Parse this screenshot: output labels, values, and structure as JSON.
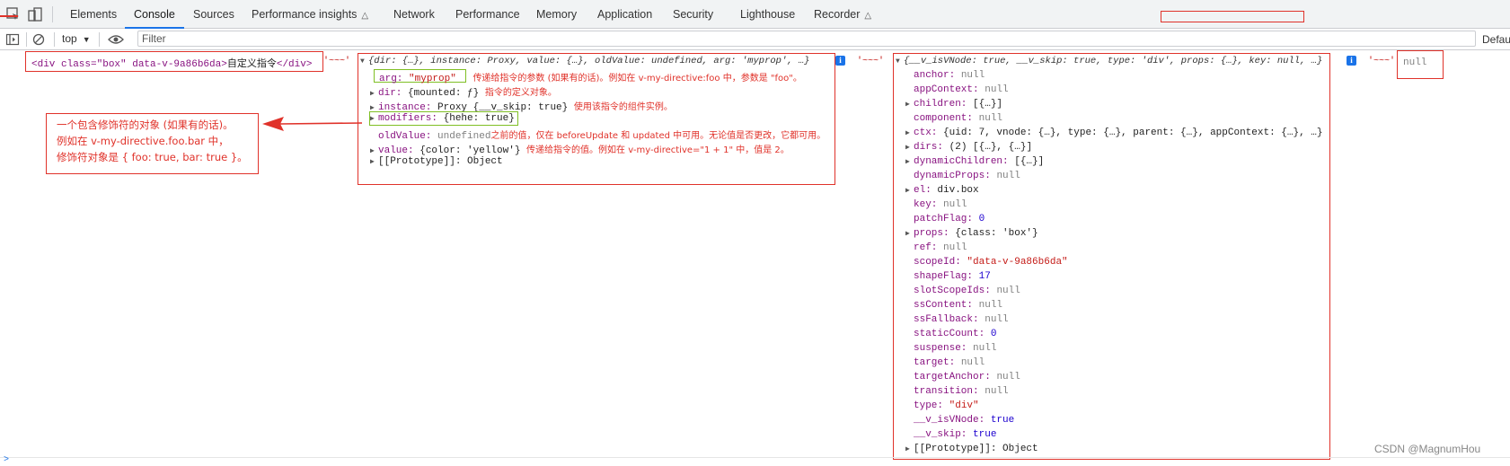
{
  "tabs": [
    "Elements",
    "Console",
    "Sources",
    "Performance insights",
    "Network",
    "Performance",
    "Memory",
    "Application",
    "Security",
    "Lighthouse",
    "Recorder"
  ],
  "toolbar": {
    "context": "top",
    "filter_placeholder": "Filter",
    "levels_label": "Defaul"
  },
  "log": {
    "element_open": "<div class=\"box\" data-v-9a86b6da>",
    "element_text": "自定义指令",
    "element_close": "</div>",
    "separator": "'~~~'",
    "binding_summary": "{dir: {…}, instance: Proxy, value: {…}, oldValue: undefined, arg: 'myprop', …}",
    "binding": {
      "arg_key": "arg:",
      "arg_val": "\"myprop\"",
      "arg_note": "传递给指令的参数 (如果有的话)。例如在 v-my-directive:foo 中，参数是 \"foo\"。",
      "dir_key": "dir:",
      "dir_val": "{mounted: ƒ}",
      "dir_note": "指令的定义对象。",
      "instance_key": "instance:",
      "instance_val": "Proxy {__v_skip: true}",
      "instance_note": "使用该指令的组件实例。",
      "modifiers_key": "modifiers:",
      "modifiers_val": "{hehe: true}",
      "oldvalue_key": "oldValue:",
      "oldvalue_val": "undefined",
      "oldvalue_note": "之前的值，仅在 beforeUpdate 和 updated 中可用。无论值是否更改，它都可用。",
      "value_key": "value:",
      "value_val": "{color: 'yellow'}",
      "value_note": "传递给指令的值。例如在 v-my-directive=\"1 + 1\" 中，值是 2。",
      "proto_key": "[[Prototype]]:",
      "proto_val": "Object"
    },
    "modifiers_callout": [
      "一个包含修饰符的对象 (如果有的话)。",
      "例如在 v-my-directive.foo.bar 中，",
      "修饰符对象是 { foo: true, bar: true }。"
    ],
    "vnode_summary": "{__v_isVNode: true, __v_skip: true, type: 'div', props: {…}, key: null, …}",
    "vnode": [
      {
        "key": "anchor:",
        "val": "null",
        "t": "nul",
        "exp": false
      },
      {
        "key": "appContext:",
        "val": "null",
        "t": "nul",
        "exp": false
      },
      {
        "key": "children:",
        "val": "[{…}]",
        "t": "pv",
        "exp": true
      },
      {
        "key": "component:",
        "val": "null",
        "t": "nul",
        "exp": false
      },
      {
        "key": "ctx:",
        "val": "{uid: 7, vnode: {…}, type: {…}, parent: {…}, appContext: {…}, …}",
        "t": "pv",
        "exp": true
      },
      {
        "key": "dirs:",
        "val": "(2) [{…}, {…}]",
        "t": "pv",
        "exp": true
      },
      {
        "key": "dynamicChildren:",
        "val": "[{…}]",
        "t": "pv",
        "exp": true
      },
      {
        "key": "dynamicProps:",
        "val": "null",
        "t": "nul",
        "exp": false
      },
      {
        "key": "el:",
        "val": "div.box",
        "t": "pv",
        "exp": true
      },
      {
        "key": "key:",
        "val": "null",
        "t": "nul",
        "exp": false
      },
      {
        "key": "patchFlag:",
        "val": "0",
        "t": "n",
        "exp": false
      },
      {
        "key": "props:",
        "val": "{class: 'box'}",
        "t": "pv",
        "exp": true
      },
      {
        "key": "ref:",
        "val": "null",
        "t": "nul",
        "exp": false
      },
      {
        "key": "scopeId:",
        "val": "\"data-v-9a86b6da\"",
        "t": "s",
        "exp": false
      },
      {
        "key": "shapeFlag:",
        "val": "17",
        "t": "n",
        "exp": false
      },
      {
        "key": "slotScopeIds:",
        "val": "null",
        "t": "nul",
        "exp": false
      },
      {
        "key": "ssContent:",
        "val": "null",
        "t": "nul",
        "exp": false
      },
      {
        "key": "ssFallback:",
        "val": "null",
        "t": "nul",
        "exp": false
      },
      {
        "key": "staticCount:",
        "val": "0",
        "t": "n",
        "exp": false
      },
      {
        "key": "suspense:",
        "val": "null",
        "t": "nul",
        "exp": false
      },
      {
        "key": "target:",
        "val": "null",
        "t": "nul",
        "exp": false
      },
      {
        "key": "targetAnchor:",
        "val": "null",
        "t": "nul",
        "exp": false
      },
      {
        "key": "transition:",
        "val": "null",
        "t": "nul",
        "exp": false
      },
      {
        "key": "type:",
        "val": "\"div\"",
        "t": "s",
        "exp": false
      },
      {
        "key": "__v_isVNode:",
        "val": "true",
        "t": "n",
        "exp": false
      },
      {
        "key": "__v_skip:",
        "val": "true",
        "t": "n",
        "exp": false
      },
      {
        "key": "[[Prototype]]:",
        "val": "Object",
        "t": "pv",
        "exp": true
      }
    ],
    "null_value": "null",
    "watermark": "CSDN @MagnumHou"
  }
}
